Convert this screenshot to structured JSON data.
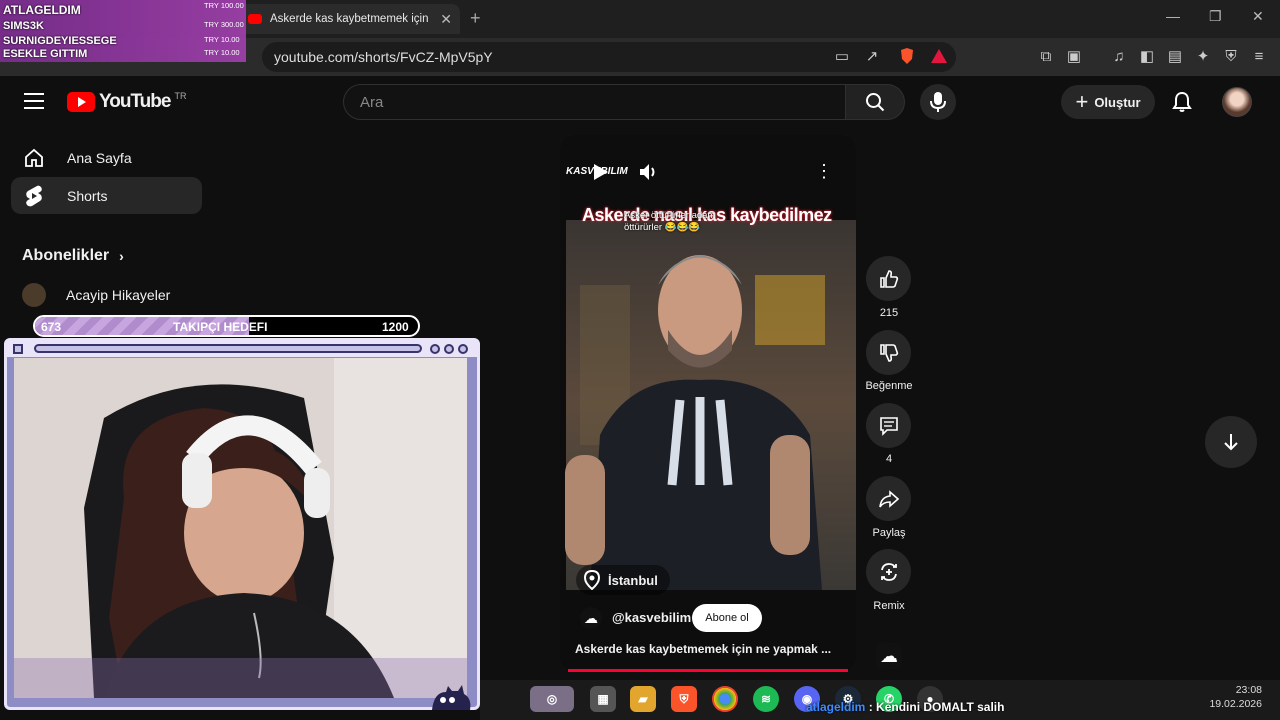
{
  "browser": {
    "tab_title": "Askerde kas kaybetmemek için ne",
    "url": "youtube.com/shorts/FvCZ-MpV5pY"
  },
  "youtube": {
    "logo_text": "YouTube",
    "country_code": "TR",
    "search_placeholder": "Ara",
    "create_label": "Oluştur"
  },
  "sidebar": {
    "items": [
      {
        "label": "Ana Sayfa",
        "icon": "home-icon"
      },
      {
        "label": "Shorts",
        "icon": "shorts-icon"
      }
    ],
    "subscriptions_label": "Abonelikler",
    "channels": [
      {
        "label": "Acayip Hikayeler"
      }
    ]
  },
  "overlay": {
    "donations": [
      {
        "name": "ATLAGELDIM",
        "amount": "TRY 100.00"
      },
      {
        "name": "SIMS3K",
        "amount": "TRY 300.00"
      },
      {
        "name": "SURNIGDEYIESSEGE",
        "amount": "TRY 10.00"
      },
      {
        "name": "ESEKLE GITTIM",
        "amount": "TRY 10.00"
      }
    ],
    "goal": {
      "current": "673",
      "label": "TAKIPÇI HEDEFI",
      "target": "1200",
      "progress": 0.56
    }
  },
  "short": {
    "title_overlay": "Askerde nasıl kas kaybedilmez",
    "caption": "Asker öttürürler adam öttürürler 😂😂😂",
    "location": "İstanbul",
    "channel": "@kasvebilim",
    "subscribe_label": "Abone ol",
    "description": "Askerde kas kaybetmemek için ne yapmak ...",
    "watermark": "KASVEBILIM",
    "actions": [
      {
        "label": "215",
        "icon": "like-icon"
      },
      {
        "label": "Beğenme",
        "icon": "dislike-icon"
      },
      {
        "label": "4",
        "icon": "comment-icon"
      },
      {
        "label": "Paylaş",
        "icon": "share-icon"
      },
      {
        "label": "Remix",
        "icon": "remix-icon"
      }
    ]
  },
  "chat": {
    "user": "atlageldim",
    "message": " : Kendini DOMALT salih"
  },
  "clock": {
    "time": "23:08",
    "date": "19.02.2026"
  },
  "colors": {
    "youtube_red": "#ff0000",
    "overlay_purple": "#9c3fa8",
    "goal_fill": "#c7a5de"
  }
}
